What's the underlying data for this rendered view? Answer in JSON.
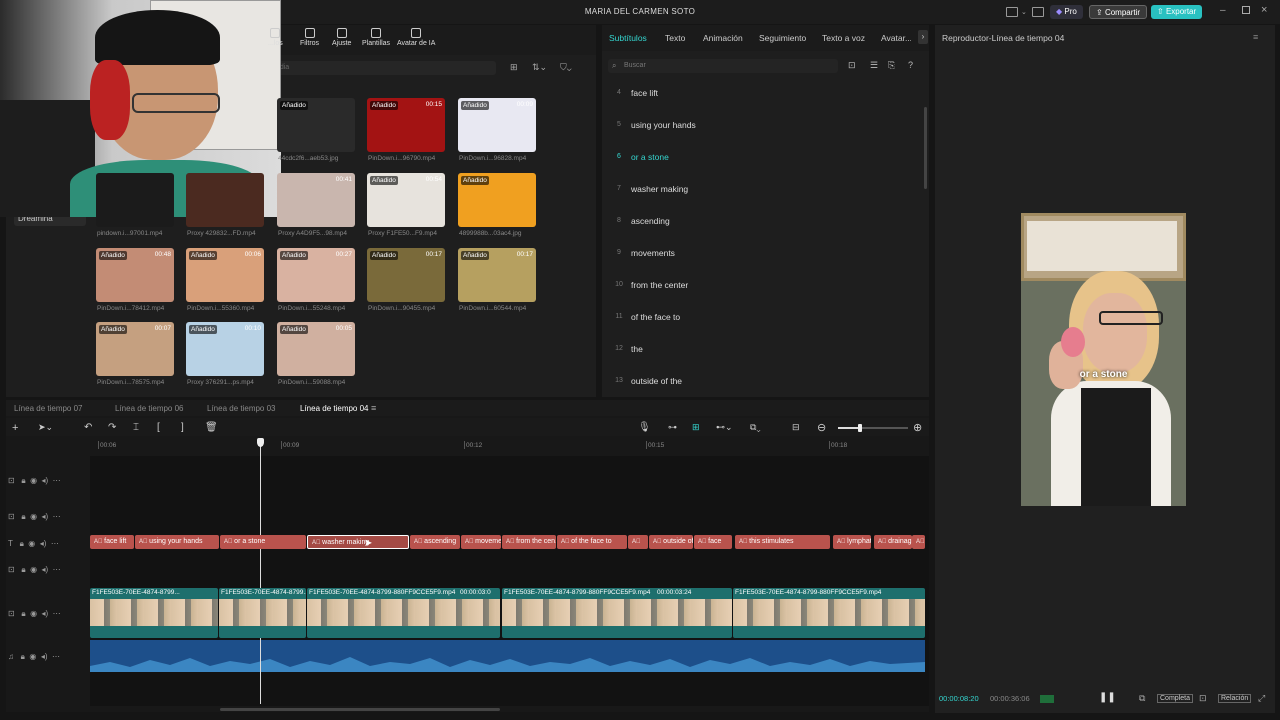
{
  "window": {
    "title": "MARIA DEL CARMEN SOTO",
    "pro_label": "Pro",
    "share_label": "Compartir",
    "export_label": "Exportar"
  },
  "media_toolbar": [
    {
      "label": "...los",
      "icon": "media-icon"
    },
    {
      "label": "Filtros",
      "icon": "filter-icon"
    },
    {
      "label": "Ajuste",
      "icon": "adjust-icon"
    },
    {
      "label": "Plantillas",
      "icon": "template-icon"
    },
    {
      "label": "Avatar de IA",
      "icon": "ai-avatar-icon"
    }
  ],
  "media_search_placeholder": "...dia",
  "sidebar_item": "Dreamina",
  "media_items": [
    {
      "name": "44cdc2f6...aeb53.jpg",
      "tag": "Añadido",
      "duration": ""
    },
    {
      "name": "PinDown.i...96790.mp4",
      "tag": "Añadido",
      "duration": "00:15"
    },
    {
      "name": "PinDown.i...96828.mp4",
      "tag": "Añadido",
      "duration": "00:09"
    },
    {
      "name": "pindown.i...97001.mp4",
      "tag": "",
      "duration": ""
    },
    {
      "name": "Proxy 429832...FD.mp4",
      "tag": "",
      "duration": ""
    },
    {
      "name": "Proxy A4D9F5...98.mp4",
      "tag": "",
      "duration": "00:41"
    },
    {
      "name": "Proxy F1FE50...F9.mp4",
      "tag": "Añadido",
      "duration": "00:54"
    },
    {
      "name": "4899988b...03ac4.jpg",
      "tag": "Añadido",
      "duration": ""
    },
    {
      "name": "PinDown.i...78412.mp4",
      "tag": "Añadido",
      "duration": "00:48"
    },
    {
      "name": "PinDown.i...55360.mp4",
      "tag": "Añadido",
      "duration": "00:06"
    },
    {
      "name": "PinDown.i...55248.mp4",
      "tag": "Añadido",
      "duration": "00:27"
    },
    {
      "name": "PinDown.i...90455.mp4",
      "tag": "Añadido",
      "duration": "00:17"
    },
    {
      "name": "PinDown.i...60544.mp4",
      "tag": "Añadido",
      "duration": "00:17"
    },
    {
      "name": "PinDown.i...78575.mp4",
      "tag": "Añadido",
      "duration": "00:07"
    },
    {
      "name": "Proxy 376291...ps.mp4",
      "tag": "Añadido",
      "duration": "00:10"
    },
    {
      "name": "PinDown.i...59088.mp4",
      "tag": "Añadido",
      "duration": "00:05"
    }
  ],
  "subs_tabs": [
    "Subtítulos",
    "Texto",
    "Animación",
    "Seguimiento",
    "Texto a voz",
    "Avatar..."
  ],
  "subs_search_placeholder": "Buscar",
  "subtitles": [
    {
      "n": "4",
      "text": "face lift"
    },
    {
      "n": "5",
      "text": "using your hands"
    },
    {
      "n": "6",
      "text": "or a stone",
      "active": true
    },
    {
      "n": "7",
      "text": "washer making"
    },
    {
      "n": "8",
      "text": "ascending"
    },
    {
      "n": "9",
      "text": "movements"
    },
    {
      "n": "10",
      "text": "from the center"
    },
    {
      "n": "11",
      "text": "of the face to"
    },
    {
      "n": "12",
      "text": "the"
    },
    {
      "n": "13",
      "text": "outside of the"
    }
  ],
  "player": {
    "title": "Reproductor-Línea de tiempo 04",
    "caption": "or a stone",
    "current_time": "00:00:08:20",
    "total_time": "00:00:36:06",
    "complete_label": "Completa",
    "ratio_label": "Relación"
  },
  "timeline_tabs": [
    "Línea de tiempo 07",
    "Línea de tiempo 06",
    "Línea de tiempo 03",
    "Línea de tiempo 04"
  ],
  "ruler_labels": [
    "00:06",
    "00:09",
    "00:12",
    "00:15",
    "00:18"
  ],
  "text_clips": [
    "face lift",
    "using your hands",
    "or a stone",
    "washer making",
    "ascending",
    "moveme...",
    "from the cen...",
    "of the face to",
    "",
    "outside of t...",
    "face",
    "this stimulates",
    "lymphat...",
    "drainag...",
    ""
  ],
  "video_clips": [
    {
      "label": "F1FE503E-70EE-4874-8799...",
      "time": ""
    },
    {
      "label": "F1FE503E-70EE-4874-8799...",
      "time": ""
    },
    {
      "label": "F1FE503E-70EE-4874-8799-880FF9CCE5F9.mp4",
      "time": "00:00:03:0"
    },
    {
      "label": "F1FE503E-70EE-4874-8799-880FF9CCE5F9.mp4",
      "time": "00:00:03:24"
    },
    {
      "label": "F1FE503E-70EE-4874-8799-880FF9CCE5F9.mp4",
      "time": ""
    }
  ]
}
